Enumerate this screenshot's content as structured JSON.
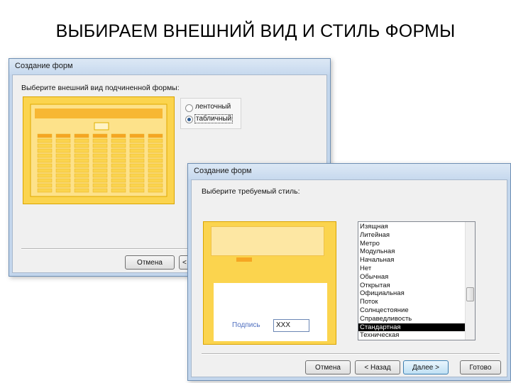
{
  "slide": {
    "title": "ВЫБИРАЕМ ВНЕШНИЙ ВИД И СТИЛЬ ФОРМЫ"
  },
  "dialog_layout": {
    "title": "Создание форм",
    "prompt": "Выберите внешний вид подчиненной формы:",
    "options": [
      {
        "label": "ленточный",
        "selected": false
      },
      {
        "label": "табличный",
        "selected": true
      }
    ],
    "cancel_label": "Отмена",
    "back_label_partial": "<"
  },
  "dialog_style": {
    "title": "Создание форм",
    "prompt": "Выберите требуемый стиль:",
    "styles": [
      "Изящная",
      "Литейная",
      "Метро",
      "Модульная",
      "Начальная",
      "Нет",
      "Обычная",
      "Открытая",
      "Официальная",
      "Поток",
      "Солнцестояние",
      "Справедливость",
      "Стандартная",
      "Техническая"
    ],
    "selected_style": "Стандартная",
    "preview_caption_label": "Подпись",
    "preview_caption_value": "XXX",
    "buttons": {
      "cancel": "Отмена",
      "back": "< Назад",
      "next": "Далее >",
      "finish": "Готово"
    }
  },
  "colors": {
    "preview_gold": "#fbd44e",
    "preview_border": "#d9a400",
    "window_frame": "#c3d6ec",
    "selection": "#000000"
  },
  "icons": [
    "radio-button-icon",
    "scrollbar-thumb-icon"
  ]
}
